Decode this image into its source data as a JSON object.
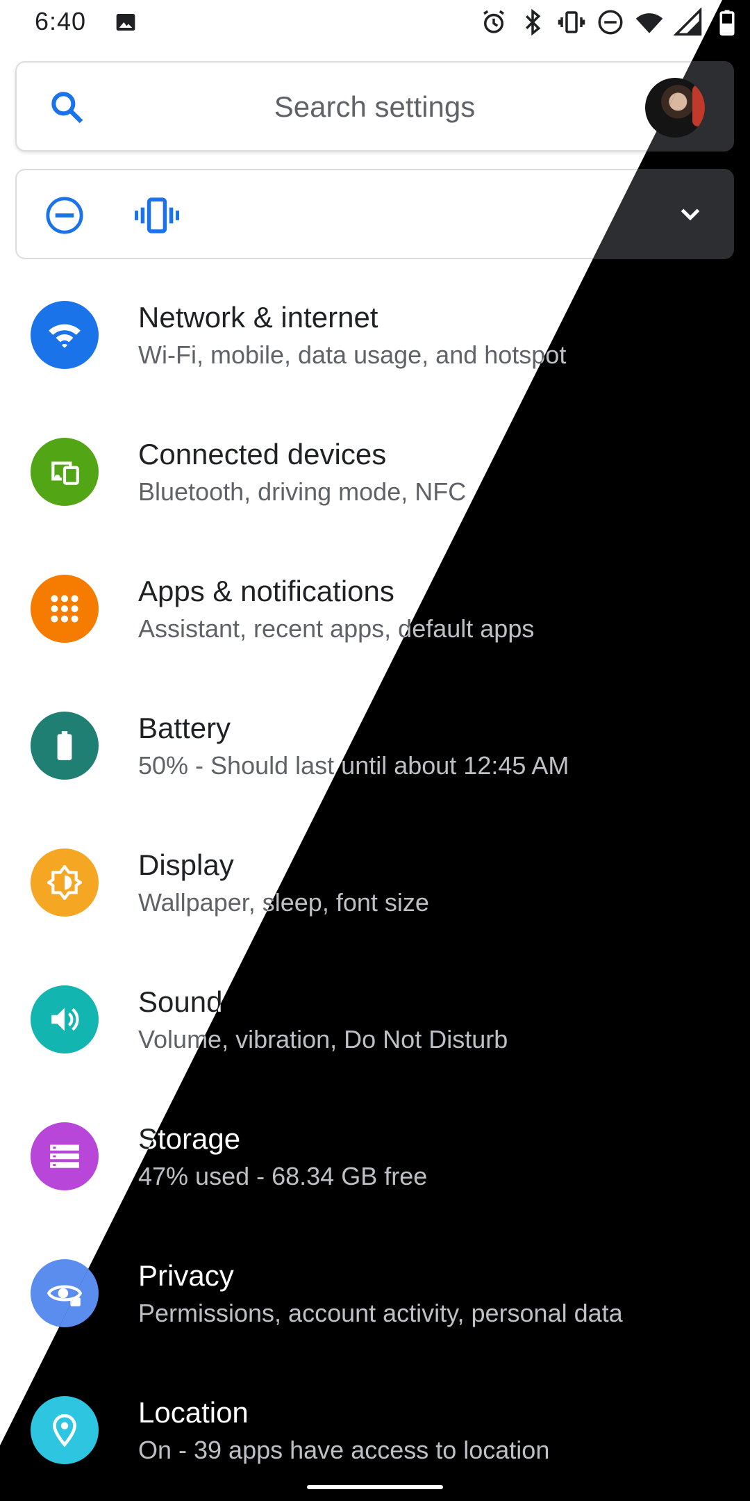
{
  "status_bar": {
    "time": "6:40",
    "icons": [
      "gallery-icon",
      "alarm-icon",
      "bluetooth-icon",
      "vibrate-icon",
      "dnd-icon",
      "wifi-icon",
      "signal-icon",
      "battery-icon"
    ]
  },
  "search": {
    "placeholder": "Search settings"
  },
  "quick_settings": {
    "icons": [
      "dnd-icon",
      "vibrate-icon",
      "chevron-down-icon"
    ]
  },
  "colors": {
    "network": "#1a73e8",
    "connected": "#52a515",
    "apps": "#f57c00",
    "battery": "#1e7f72",
    "display": "#f5a623",
    "sound": "#12b5b0",
    "storage": "#b846d9",
    "privacy": "#5b8def",
    "location": "#2ec5e0",
    "accent": "#1a73e8"
  },
  "items": [
    {
      "title": "Network & internet",
      "subtitle": "Wi-Fi, mobile, data usage, and hotspot"
    },
    {
      "title": "Connected devices",
      "subtitle": "Bluetooth, driving mode, NFC"
    },
    {
      "title": "Apps & notifications",
      "subtitle": "Assistant, recent apps, default apps"
    },
    {
      "title": "Battery",
      "subtitle": "50% - Should last until about 12:45 AM"
    },
    {
      "title": "Display",
      "subtitle": "Wallpaper, sleep, font size"
    },
    {
      "title": "Sound",
      "subtitle": "Volume, vibration, Do Not Disturb"
    },
    {
      "title": "Storage",
      "subtitle": "47% used - 68.34 GB free"
    },
    {
      "title": "Privacy",
      "subtitle": "Permissions, account activity, personal data"
    },
    {
      "title": "Location",
      "subtitle": "On - 39 apps have access to location"
    }
  ]
}
